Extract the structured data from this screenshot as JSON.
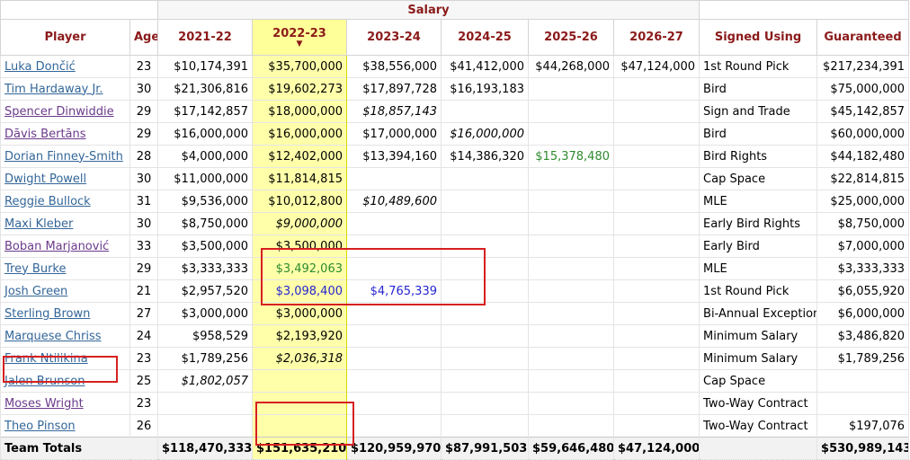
{
  "header": {
    "salary_group": "Salary",
    "columns": [
      "Player",
      "Age",
      "2021-22",
      "2022-23",
      "2023-24",
      "2024-25",
      "2025-26",
      "2026-27",
      "Signed Using",
      "Guaranteed"
    ],
    "sort_indicator": "▼"
  },
  "rows": [
    {
      "player": "Luka Dončić",
      "age": "23",
      "y2122": "$10,174,391",
      "y2223": "$35,700,000",
      "y2324": "$38,556,000",
      "y2425": "$41,412,000",
      "y2526": "$44,268,000",
      "y2627": "$47,124,000",
      "signed": "1st Round Pick",
      "guaranteed": "$217,234,391"
    },
    {
      "player": "Tim Hardaway Jr.",
      "age": "30",
      "y2122": "$21,306,816",
      "y2223": "$19,602,273",
      "y2324": "$17,897,728",
      "y2425": "$16,193,183",
      "y2526": "",
      "y2627": "",
      "signed": "Bird",
      "guaranteed": "$75,000,000"
    },
    {
      "player": "Spencer Dinwiddie",
      "age": "29",
      "y2122": "$17,142,857",
      "y2223": "$18,000,000",
      "y2324": "$18,857,143",
      "y2425": "",
      "y2526": "",
      "y2627": "",
      "signed": "Sign and Trade",
      "guaranteed": "$45,142,857"
    },
    {
      "player": "Dāvis Bertāns",
      "age": "29",
      "y2122": "$16,000,000",
      "y2223": "$16,000,000",
      "y2324": "$17,000,000",
      "y2425": "$16,000,000",
      "y2526": "",
      "y2627": "",
      "signed": "Bird",
      "guaranteed": "$60,000,000"
    },
    {
      "player": "Dorian Finney-Smith",
      "age": "28",
      "y2122": "$4,000,000",
      "y2223": "$12,402,000",
      "y2324": "$13,394,160",
      "y2425": "$14,386,320",
      "y2526": "$15,378,480",
      "y2627": "",
      "signed": "Bird Rights",
      "guaranteed": "$44,182,480"
    },
    {
      "player": "Dwight Powell",
      "age": "30",
      "y2122": "$11,000,000",
      "y2223": "$11,814,815",
      "y2324": "",
      "y2425": "",
      "y2526": "",
      "y2627": "",
      "signed": "Cap Space",
      "guaranteed": "$22,814,815"
    },
    {
      "player": "Reggie Bullock",
      "age": "31",
      "y2122": "$9,536,000",
      "y2223": "$10,012,800",
      "y2324": "$10,489,600",
      "y2425": "",
      "y2526": "",
      "y2627": "",
      "signed": "MLE",
      "guaranteed": "$25,000,000"
    },
    {
      "player": "Maxi Kleber",
      "age": "30",
      "y2122": "$8,750,000",
      "y2223": "$9,000,000",
      "y2324": "",
      "y2425": "",
      "y2526": "",
      "y2627": "",
      "signed": "Early Bird Rights",
      "guaranteed": "$8,750,000"
    },
    {
      "player": "Boban Marjanović",
      "age": "33",
      "y2122": "$3,500,000",
      "y2223": "$3,500,000",
      "y2324": "",
      "y2425": "",
      "y2526": "",
      "y2627": "",
      "signed": "Early Bird",
      "guaranteed": "$7,000,000"
    },
    {
      "player": "Trey Burke",
      "age": "29",
      "y2122": "$3,333,333",
      "y2223": "$3,492,063",
      "y2324": "",
      "y2425": "",
      "y2526": "",
      "y2627": "",
      "signed": "MLE",
      "guaranteed": "$3,333,333"
    },
    {
      "player": "Josh Green",
      "age": "21",
      "y2122": "$2,957,520",
      "y2223": "$3,098,400",
      "y2324": "$4,765,339",
      "y2425": "",
      "y2526": "",
      "y2627": "",
      "signed": "1st Round Pick",
      "guaranteed": "$6,055,920"
    },
    {
      "player": "Sterling Brown",
      "age": "27",
      "y2122": "$3,000,000",
      "y2223": "$3,000,000",
      "y2324": "",
      "y2425": "",
      "y2526": "",
      "y2627": "",
      "signed": "Bi-Annual Exception",
      "guaranteed": "$6,000,000"
    },
    {
      "player": "Marquese Chriss",
      "age": "24",
      "y2122": "$958,529",
      "y2223": "$2,193,920",
      "y2324": "",
      "y2425": "",
      "y2526": "",
      "y2627": "",
      "signed": "Minimum Salary",
      "guaranteed": "$3,486,820"
    },
    {
      "player": "Frank Ntilikina",
      "age": "23",
      "y2122": "$1,789,256",
      "y2223": "$2,036,318",
      "y2324": "",
      "y2425": "",
      "y2526": "",
      "y2627": "",
      "signed": "Minimum Salary",
      "guaranteed": "$1,789,256"
    },
    {
      "player": "Jalen Brunson",
      "age": "25",
      "y2122": "$1,802,057",
      "y2223": "",
      "y2324": "",
      "y2425": "",
      "y2526": "",
      "y2627": "",
      "signed": "Cap Space",
      "guaranteed": ""
    },
    {
      "player": "Moses Wright",
      "age": "23",
      "y2122": "",
      "y2223": "",
      "y2324": "",
      "y2425": "",
      "y2526": "",
      "y2627": "",
      "signed": "Two-Way Contract",
      "guaranteed": ""
    },
    {
      "player": "Theo Pinson",
      "age": "26",
      "y2122": "",
      "y2223": "",
      "y2324": "",
      "y2425": "",
      "y2526": "",
      "y2627": "",
      "signed": "Two-Way Contract",
      "guaranteed": "$197,076"
    }
  ],
  "totals": {
    "label": "Team Totals",
    "y2122": "$118,470,333",
    "y2223": "$151,635,210",
    "y2324": "$120,959,970",
    "y2425": "$87,991,503",
    "y2526": "$59,646,480",
    "y2627": "$47,124,000",
    "signed": "",
    "guaranteed": "$530,989,143"
  },
  "colors": {
    "header_text": "#8b1a1a",
    "link": "#336699",
    "visited_link": "#6b3a8b",
    "sorted_column": "#ffffaa",
    "option_green": "#2e8b2e",
    "option_blue": "#2525d0",
    "annotation_red": "#d62020"
  }
}
